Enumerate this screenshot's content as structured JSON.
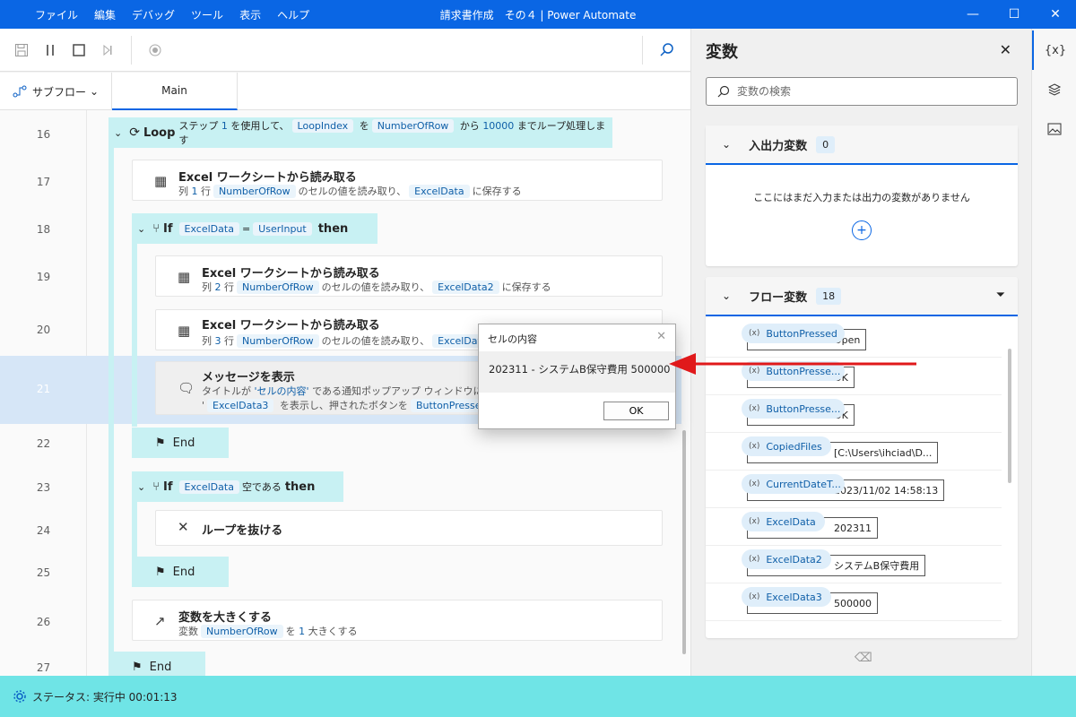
{
  "window": {
    "title": "請求書作成　その４ | Power Automate",
    "menus": [
      "ファイル",
      "編集",
      "デバッグ",
      "ツール",
      "表示",
      "ヘルプ"
    ],
    "minimize_glyph": "—",
    "maximize_glyph": "☐",
    "close_glyph": "✕"
  },
  "tabs": {
    "subflow_label": "サブフロー",
    "main_label": "Main"
  },
  "flow": {
    "line_numbers": [
      "16",
      "17",
      "18",
      "19",
      "20",
      "21",
      "22",
      "23",
      "24",
      "25",
      "26",
      "27"
    ],
    "loop": {
      "keyword": "Loop",
      "t1": "ステップ",
      "step": "1",
      "t2": "を使用して、",
      "var": "LoopIndex",
      "t3": "を",
      "from_var": "NumberOfRow",
      "t4": "から",
      "to": "10000",
      "t5": "までループ処理します"
    },
    "a17": {
      "title": "Excel ワークシートから読み取る",
      "d1": "列",
      "col": "1",
      "d2": "行",
      "row_var": "NumberOfRow",
      "d3": "のセルの値を読み取り、",
      "out_var": "ExcelData",
      "d4": "に保存する"
    },
    "if18": {
      "keyword": "If",
      "left": "ExcelData",
      "op": "=",
      "right": "UserInput",
      "then": "then"
    },
    "a19": {
      "title": "Excel ワークシートから読み取る",
      "d1": "列",
      "col": "2",
      "d2": "行",
      "row_var": "NumberOfRow",
      "d3": "のセルの値を読み取り、",
      "out_var": "ExcelData2",
      "d4": "に保存する"
    },
    "a20": {
      "title": "Excel ワークシートから読み取る",
      "d1": "列",
      "col": "3",
      "d2": "行",
      "row_var": "NumberOfRow",
      "d3": "のセルの値を読み取り、",
      "out_var": "ExcelData"
    },
    "a21": {
      "title": "メッセージを表示",
      "d1": "タイトルが",
      "title_val": "'セルの内容'",
      "d2": "である通知ポップアップ ウィンドウにメッセージ",
      "q": "'",
      "msg_var": "ExcelData3",
      "d3": "を表示し、押されたボタンを",
      "btn_var": "ButtonPressed3"
    },
    "end22": "End",
    "if23": {
      "keyword": "If",
      "var": "ExcelData",
      "cond": "空である",
      "then": "then"
    },
    "a24": {
      "title": "ループを抜ける"
    },
    "end25": "End",
    "a26": {
      "title": "変数を大きくする",
      "d1": "変数",
      "var": "NumberOfRow",
      "d2": "を",
      "amount": "1",
      "d3": "大きくする"
    },
    "end27": "End"
  },
  "status": {
    "text": "ステータス: 実行中  00:01:13"
  },
  "variables": {
    "title": "変数",
    "search_placeholder": "変数の検索",
    "io": {
      "name": "入出力変数",
      "count": "0",
      "empty": "ここにはまだ入力または出力の変数がありません"
    },
    "flow": {
      "name": "フロー変数",
      "count": "18",
      "items": [
        {
          "name": "ButtonPressed",
          "value": "Open"
        },
        {
          "name": "ButtonPresse...",
          "value": "OK"
        },
        {
          "name": "ButtonPresse...",
          "value": "OK"
        },
        {
          "name": "CopiedFiles",
          "value": "[C:\\Users\\ihciad\\D..."
        },
        {
          "name": "CurrentDateT...",
          "value": "2023/11/02 14:58:13"
        },
        {
          "name": "ExcelData",
          "value": "202311"
        },
        {
          "name": "ExcelData2",
          "value": "システムB保守費用"
        },
        {
          "name": "ExcelData3",
          "value": "500000"
        }
      ]
    }
  },
  "sidebar": {
    "vars_label": "{x}"
  },
  "dialog": {
    "title": "セルの内容",
    "message": "202311 - システムB保守費用 500000",
    "ok": "OK"
  },
  "colors": {
    "titlebar": "#0a66e4",
    "loop_block": "#c8f1f3",
    "status_bar": "#6fe4e6",
    "arrow": "#e0191b"
  }
}
